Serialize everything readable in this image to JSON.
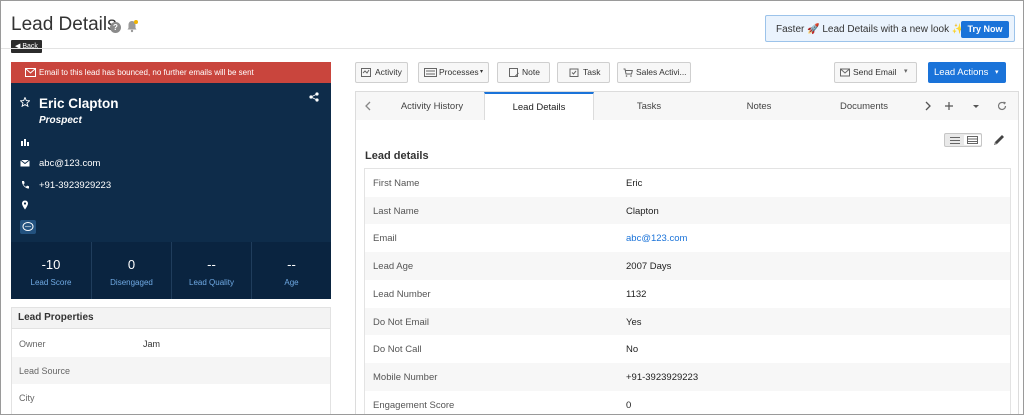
{
  "header": {
    "title": "Lead Details",
    "help_glyph": "?",
    "back_label": "Back",
    "promo_text": "Faster 🚀 Lead Details with a new look ✨",
    "promo_button": "Try Now"
  },
  "lead": {
    "bounce_message": "Email to this lead has bounced, no further emails will be sent",
    "name": "Eric Clapton",
    "stage": "Prospect",
    "email": "abc@123.com",
    "phone": "+91-3923929223",
    "stats": [
      {
        "value": "-10",
        "label": "Lead Score"
      },
      {
        "value": "0",
        "label": "Disengaged"
      },
      {
        "value": "--",
        "label": "Lead Quality"
      },
      {
        "value": "--",
        "label": "Age"
      }
    ]
  },
  "properties": {
    "title": "Lead Properties",
    "rows": [
      {
        "label": "Owner",
        "value": "Jam"
      },
      {
        "label": "Lead Source",
        "value": ""
      },
      {
        "label": "City",
        "value": ""
      }
    ]
  },
  "toolbar": {
    "activity": "Activity",
    "processes": "Processes",
    "note": "Note",
    "task": "Task",
    "sales_activity": "Sales Activi...",
    "send_email": "Send Email",
    "lead_actions": "Lead Actions"
  },
  "tabs": [
    {
      "label": "Activity History",
      "active": false
    },
    {
      "label": "Lead Details",
      "active": true
    },
    {
      "label": "Tasks",
      "active": false
    },
    {
      "label": "Notes",
      "active": false
    },
    {
      "label": "Documents",
      "active": false
    }
  ],
  "details": {
    "title": "Lead details",
    "rows": [
      {
        "label": "First Name",
        "value": "Eric"
      },
      {
        "label": "Last Name",
        "value": "Clapton"
      },
      {
        "label": "Email",
        "value": "abc@123.com"
      },
      {
        "label": "Lead Age",
        "value": "2007 Days"
      },
      {
        "label": "Lead Number",
        "value": "1132"
      },
      {
        "label": "Do Not Email",
        "value": "Yes"
      },
      {
        "label": "Do Not Call",
        "value": "No"
      },
      {
        "label": "Mobile Number",
        "value": "+91-3923929223"
      },
      {
        "label": "Engagement Score",
        "value": "0"
      }
    ]
  },
  "colors": {
    "accent": "#1a73d9",
    "card": "#0e2c4a",
    "bounce": "#c9453d"
  }
}
